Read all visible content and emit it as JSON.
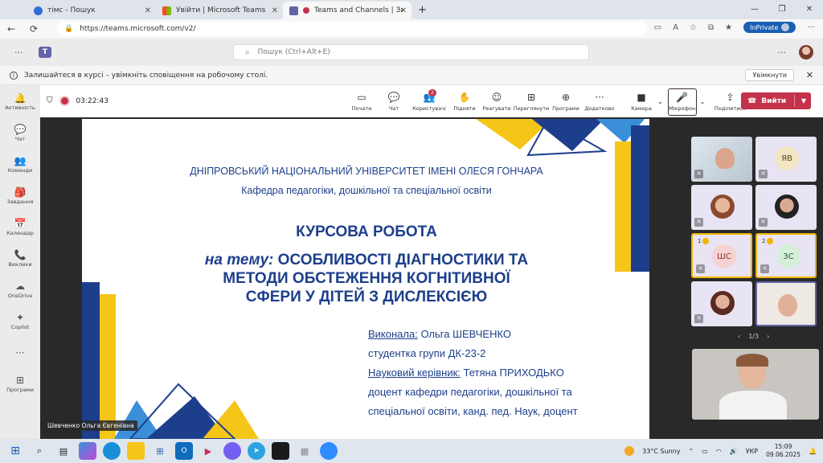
{
  "browser": {
    "tabs": [
      {
        "label": "тімс - Пошук",
        "icon_color": "#2f6fd6"
      },
      {
        "label": "Увійти | Microsoft Teams",
        "icon_color": "#f25022"
      },
      {
        "label": "Teams and Channels | Захис",
        "icon_color": "#c4314b"
      }
    ],
    "new_tab": "+",
    "url": "https://teams.microsoft.com/v2/",
    "inprivate": "InPrivate"
  },
  "teams": {
    "search_placeholder": "Пошук (Ctrl+Alt+E)",
    "notification": {
      "text": "Залишайтеся в курсі – увімкніть сповіщення на робочому столі.",
      "button": "Увімкнути"
    },
    "rail": [
      {
        "label": "Активність",
        "icon": "bell-icon",
        "glyph": "🔔"
      },
      {
        "label": "Чат",
        "icon": "chat-icon",
        "glyph": "💬"
      },
      {
        "label": "Команди",
        "icon": "teams-icon",
        "glyph": "👥"
      },
      {
        "label": "Завдання",
        "icon": "assignments-icon",
        "glyph": "🎒"
      },
      {
        "label": "Календар",
        "icon": "calendar-icon",
        "glyph": "📅"
      },
      {
        "label": "Виклики",
        "icon": "phone-icon",
        "glyph": "📞"
      },
      {
        "label": "OneDrive",
        "icon": "cloud-icon",
        "glyph": "☁"
      },
      {
        "label": "Copilot",
        "icon": "copilot-icon",
        "glyph": "✦"
      },
      {
        "label": "",
        "icon": "more-icon",
        "glyph": "···"
      },
      {
        "label": "Програми",
        "icon": "apps-icon",
        "glyph": "⊞"
      }
    ]
  },
  "meeting": {
    "timer": "03:22:43",
    "tools": [
      {
        "label": "Почати",
        "icon": "whiteboard-icon",
        "glyph": "▭"
      },
      {
        "label": "Чат",
        "icon": "chat-icon",
        "glyph": "💬"
      },
      {
        "label": "Користувачі",
        "icon": "people-icon",
        "glyph": "👥",
        "badge": "2"
      },
      {
        "label": "Підняти",
        "icon": "raise-hand-icon",
        "glyph": "✋"
      },
      {
        "label": "Реагувати",
        "icon": "react-icon",
        "glyph": "☺"
      },
      {
        "label": "Переглянути",
        "icon": "view-icon",
        "glyph": "⊞"
      },
      {
        "label": "Програми",
        "icon": "apps-icon",
        "glyph": "⊕"
      },
      {
        "label": "Додатково",
        "icon": "more-icon",
        "glyph": "···"
      },
      {
        "label": "Камера",
        "icon": "camera-icon",
        "glyph": "▶"
      },
      {
        "label": "Мікрофон",
        "icon": "microphone-icon",
        "glyph": "🎤"
      },
      {
        "label": "Поділитися",
        "icon": "share-icon",
        "glyph": "⇪"
      }
    ],
    "leave": "Вийти",
    "presenter_name": "Шевченко Ольга Євгенівна",
    "pager": "1/3",
    "participants": [
      {
        "initials": "",
        "type": "photo"
      },
      {
        "initials": "ЯВ",
        "type": "avatar",
        "color": "#f3e6c3"
      },
      {
        "initials": "",
        "type": "photo"
      },
      {
        "initials": "",
        "type": "photo"
      },
      {
        "initials": "ШС",
        "type": "avatar",
        "color": "#f6d3d3",
        "hand": "1"
      },
      {
        "initials": "ЗС",
        "type": "avatar",
        "color": "#d6efdb",
        "hand": "2"
      },
      {
        "initials": "",
        "type": "photo"
      },
      {
        "initials": "",
        "type": "photo"
      }
    ]
  },
  "slide": {
    "university": "ДНІПРОВСЬКИЙ НАЦІОНАЛЬНИЙ УНІВЕРСИТЕТ ІМЕНІ ОЛЕСЯ ГОНЧАРА",
    "department": "Кафедра педагогіки, дошкільної та спеціальної освіти",
    "title": "КУРСОВА РОБОТА",
    "topic_prefix": "на тему:",
    "topic_line1": " ОСОБЛИВОСТІ ДІАГНОСТИКИ ТА",
    "topic_line2": "МЕТОДИ ОБСТЕЖЕННЯ КОГНІТИВНОЇ",
    "topic_line3": "СФЕРИ У ДІТЕЙ З ДИСЛЕКСІЄЮ",
    "performed_label": "Виконала:",
    "performed_value": " Ольга ШЕВЧЕНКО",
    "group": "студентка групи ДК-23-2",
    "supervisor_label": "Науковий керівник:",
    "supervisor_value": " Тетяна ПРИХОДЬКО",
    "supervisor_line2": "доцент кафедри педагогіки, дошкільної та",
    "supervisor_line3": "спеціальної освіти, канд. пед. Наук, доцент",
    "colors": {
      "blue": "#1d3f8b",
      "yellow": "#f5c518",
      "light_blue": "#3b8fd9"
    }
  },
  "taskbar": {
    "weather": "33°C  Sunny",
    "lang": "УКР",
    "time": "15:09",
    "date": "09.06.2025"
  }
}
